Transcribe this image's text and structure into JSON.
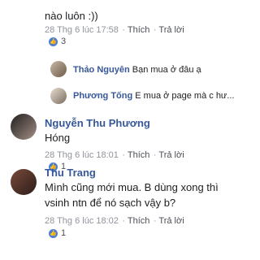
{
  "actions": {
    "like": "Thích",
    "reply": "Trả lời"
  },
  "comment_top": {
    "text_partial": "nào luôn :))",
    "time": "28 Thg 6 lúc 17:58",
    "reactions": "3"
  },
  "replies": [
    {
      "name": "Thảo Nguyên",
      "text": "Bạn mua ở đâu ạ"
    },
    {
      "name": "Phương Tống",
      "text": "E mua ở page mà c hư..."
    }
  ],
  "comment_phuong": {
    "name": "Nguyễn Thu Phương",
    "text": "Hóng",
    "time": "28 Thg 6 lúc 18:01",
    "reactions": "1"
  },
  "comment_trang": {
    "name": "Thu Trang",
    "text_line1": "Mình cũng mới mua. B dùng xong thì",
    "text_line2": "vsinh ntn để nó sạch vậy b?",
    "time": "28 Thg 6 lúc 18:02",
    "reactions": "1"
  },
  "colors": {
    "name": "#365899",
    "meta": "#90949c",
    "like_icon": "#4a7dd8"
  }
}
